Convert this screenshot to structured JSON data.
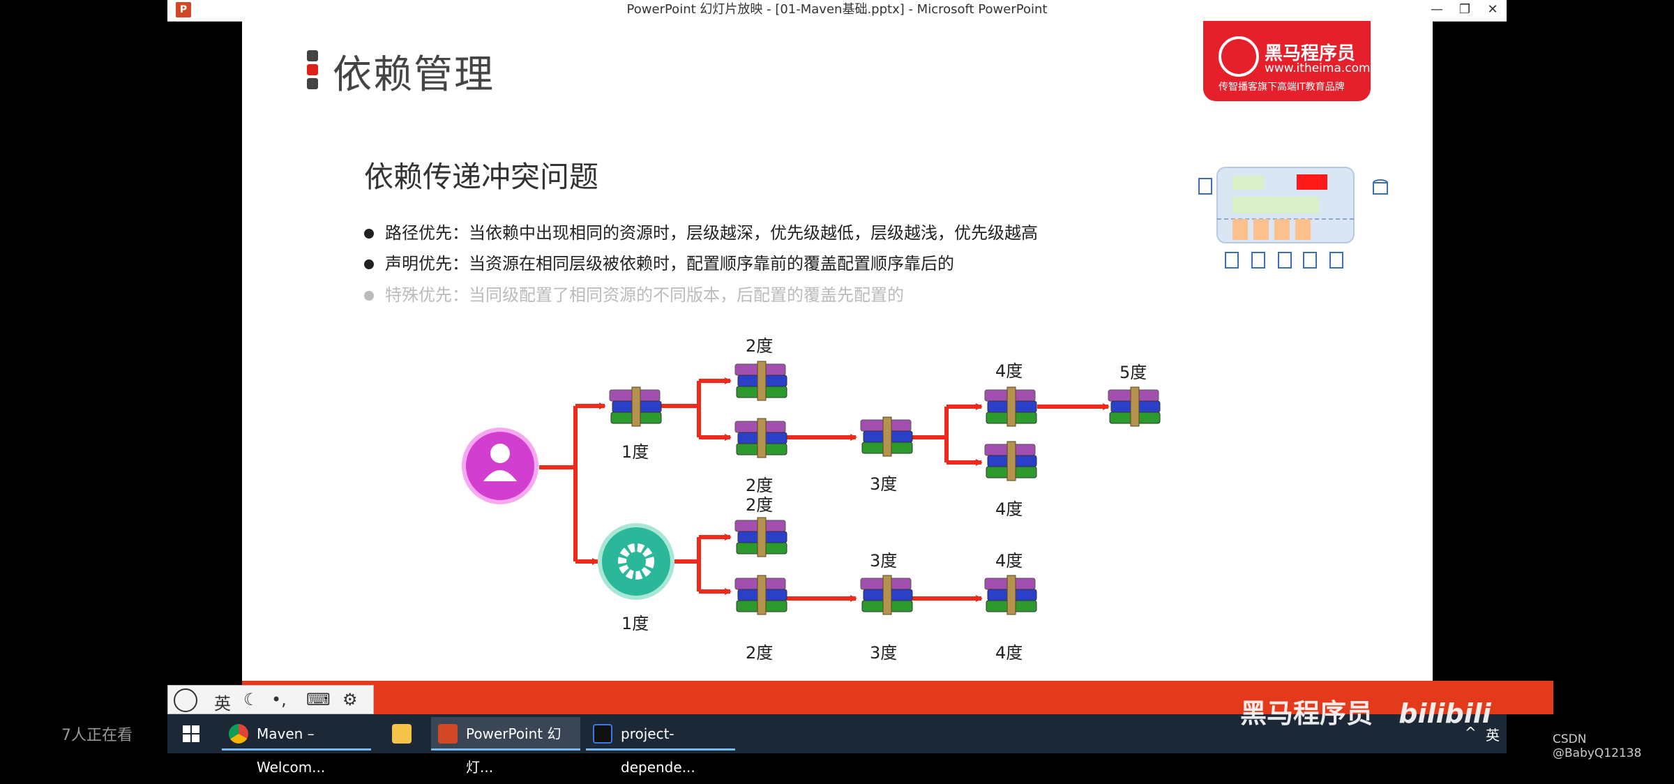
{
  "window": {
    "title": "PowerPoint 幻灯片放映 - [01-Maven基础.pptx] - Microsoft PowerPoint",
    "minimize": "—",
    "restore": "❐",
    "close": "✕"
  },
  "slide": {
    "title": "依赖管理",
    "subtitle": "依赖传递冲突问题",
    "bullets": [
      "路径优先：当依赖中出现相同的资源时，层级越深，优先级越低，层级越浅，优先级越高",
      "声明优先：当资源在相同层级被依赖时，配置顺序靠前的覆盖配置顺序靠后的",
      "特殊优先：当同级配置了相同资源的不同版本，后配置的覆盖先配置的"
    ],
    "logo": {
      "name": "黑马程序员",
      "url": "www.itheima.com",
      "slogan": "传智播客旗下高端IT教育品牌"
    },
    "diagram": {
      "labels": {
        "t_1": "1度",
        "t_2a": "2度",
        "t_2b": "2度",
        "t_2c": "2度",
        "t_2d": "2度",
        "t_3a": "3度",
        "t_3b": "3度",
        "t_3c": "3度",
        "t_4a": "4度",
        "t_4b": "4度",
        "t_4c": "4度",
        "t_4d": "4度",
        "t_5": "5度",
        "b_1": "1度"
      },
      "colors": {
        "arrow": "#ee2a1a",
        "user_node": "#d23fd0",
        "gear_node": "#2bb89a"
      }
    }
  },
  "ime": {
    "lang": "英",
    "moon": "☾",
    "punct": "•,",
    "keyboard": "⌨",
    "settings": "⚙"
  },
  "viewers": "7人正在看",
  "taskbar": {
    "items": [
      "Maven – Welcom...",
      "",
      "PowerPoint 幻灯...",
      "project-depende..."
    ],
    "tray_lang": "英",
    "tray_up": "^"
  },
  "watermark": {
    "brand": "黑马程序员",
    "site": "bilibili",
    "csdn": "CSDN @BabyQ12138"
  }
}
